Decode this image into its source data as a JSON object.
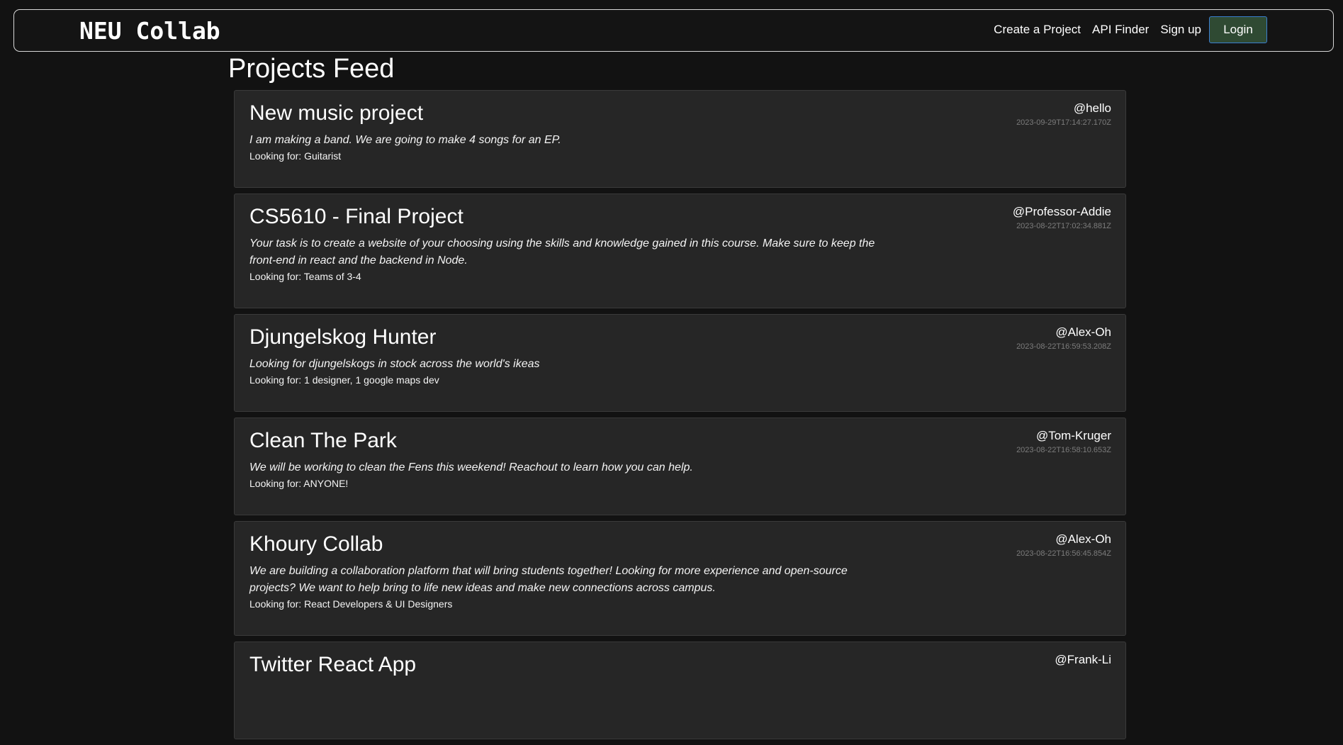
{
  "navbar": {
    "brand": "NEU Collab",
    "links": [
      "Create a Project",
      "API Finder",
      "Sign up"
    ],
    "login_label": "Login"
  },
  "page_title": "Projects Feed",
  "looking_prefix": "Looking for: ",
  "projects": [
    {
      "title": "New music project",
      "description": "I am making a band. We are going to make 4 songs for an EP.",
      "looking_for": "Guitarist",
      "author": "@hello",
      "date": "2023-09-29T17:14:27.170Z"
    },
    {
      "title": "CS5610 - Final Project",
      "description": "Your task is to create a website of your choosing using the skills and knowledge gained in this course. Make sure to keep the front-end in react and the backend in Node.",
      "looking_for": "Teams of 3-4",
      "author": "@Professor-Addie",
      "date": "2023-08-22T17:02:34.881Z"
    },
    {
      "title": "Djungelskog Hunter",
      "description": "Looking for djungelskogs in stock across the world's ikeas",
      "looking_for": "1 designer, 1 google maps dev",
      "author": "@Alex-Oh",
      "date": "2023-08-22T16:59:53.208Z"
    },
    {
      "title": "Clean The Park",
      "description": "We will be working to clean the Fens this weekend! Reachout to learn how you can help.",
      "looking_for": "ANYONE!",
      "author": "@Tom-Kruger",
      "date": "2023-08-22T16:58:10.653Z"
    },
    {
      "title": "Khoury Collab",
      "description": "We are building a collaboration platform that will bring students together! Looking for more experience and open-source projects? We want to help bring to life new ideas and make new connections across campus.",
      "looking_for": "React Developers & UI Designers",
      "author": "@Alex-Oh",
      "date": "2023-08-22T16:56:45.854Z"
    },
    {
      "title": "Twitter React App",
      "description": "",
      "looking_for": "",
      "author": "@Frank-Li",
      "date": ""
    }
  ]
}
